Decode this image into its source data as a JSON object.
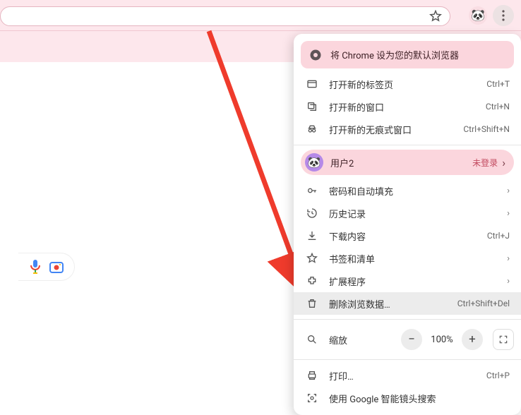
{
  "topbar": {
    "avatar_emoji": "🐼"
  },
  "promo": {
    "text": "将 Chrome 设为您的默认浏览器"
  },
  "user": {
    "name": "用户2",
    "status": "未登录",
    "emoji": "🐼"
  },
  "menu": {
    "new_tab": {
      "label": "打开新的标签页",
      "shortcut": "Ctrl+T"
    },
    "new_window": {
      "label": "打开新的窗口",
      "shortcut": "Ctrl+N"
    },
    "incognito": {
      "label": "打开新的无痕式窗口",
      "shortcut": "Ctrl+Shift+N"
    },
    "passwords": {
      "label": "密码和自动填充"
    },
    "history": {
      "label": "历史记录"
    },
    "downloads": {
      "label": "下载内容",
      "shortcut": "Ctrl+J"
    },
    "bookmarks": {
      "label": "书签和清单"
    },
    "extensions": {
      "label": "扩展程序"
    },
    "clear_data": {
      "label": "删除浏览数据…",
      "shortcut": "Ctrl+Shift+Del"
    },
    "zoom": {
      "label": "缩放",
      "value": "100%"
    },
    "print": {
      "label": "打印…",
      "shortcut": "Ctrl+P"
    },
    "lens": {
      "label": "使用 Google 智能镜头搜索"
    }
  }
}
